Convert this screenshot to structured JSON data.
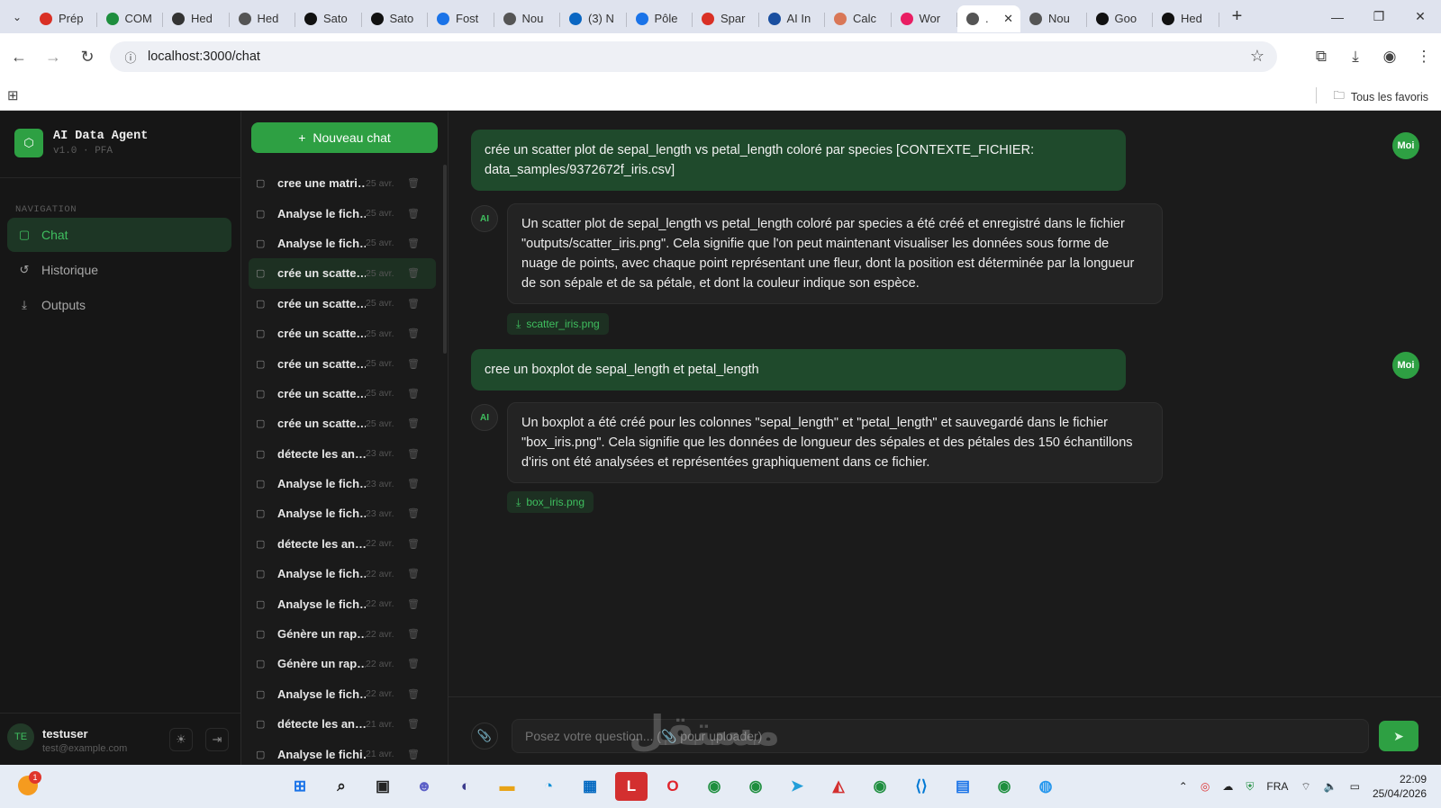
{
  "browser": {
    "tabs": [
      {
        "label": "Prép",
        "icon": "gmail-icon",
        "color": "#d93025"
      },
      {
        "label": "COM",
        "icon": "drive-icon",
        "color": "#1e8e3e"
      },
      {
        "label": "Hed",
        "icon": "hed-icon",
        "color": "#333333"
      },
      {
        "label": "Hed",
        "icon": "globe-icon",
        "color": "#555555"
      },
      {
        "label": "Sato",
        "icon": "sato-icon",
        "color": "#111111"
      },
      {
        "label": "Sato",
        "icon": "sato-icon",
        "color": "#111111"
      },
      {
        "label": "Fost",
        "icon": "fost-icon",
        "color": "#1a73e8"
      },
      {
        "label": "Nou",
        "icon": "globe-icon",
        "color": "#555555"
      },
      {
        "label": "(3) N",
        "icon": "linkedin-icon",
        "color": "#0a66c2"
      },
      {
        "label": "Pôle",
        "icon": "search-icon",
        "color": "#1a73e8"
      },
      {
        "label": "Spar",
        "icon": "gmail-icon",
        "color": "#d93025"
      },
      {
        "label": "AI In",
        "icon": "doc-icon",
        "color": "#1a4fa0"
      },
      {
        "label": "Calc",
        "icon": "claude-icon",
        "color": "#d97757"
      },
      {
        "label": "Wor",
        "icon": "wor-icon",
        "color": "#e91e63"
      },
      {
        "label": ".",
        "icon": "globe-icon",
        "color": "#555555",
        "active": true
      },
      {
        "label": "Nou",
        "icon": "globe-icon",
        "color": "#555555"
      },
      {
        "label": "Goo",
        "icon": "openai-icon",
        "color": "#111111"
      },
      {
        "label": "Hed",
        "icon": "openai-icon",
        "color": "#111111"
      }
    ],
    "url": "localhost:3000/chat",
    "favorites_label": "Tous les favoris"
  },
  "app": {
    "brand_title": "AI Data Agent",
    "brand_sub": "v1.0 · PFA",
    "nav_title": "NAVIGATION",
    "nav": [
      {
        "label": "Chat",
        "icon": "chat-icon",
        "active": true
      },
      {
        "label": "Historique",
        "icon": "history-icon",
        "active": false
      },
      {
        "label": "Outputs",
        "icon": "download-icon",
        "active": false
      }
    ],
    "user": {
      "initials": "TE",
      "name": "testuser",
      "email": "test@example.com"
    },
    "new_chat_label": "Nouveau chat",
    "history": [
      {
        "title": "cree une matri…",
        "date": "25 avr."
      },
      {
        "title": "Analyse le fich…",
        "date": "25 avr."
      },
      {
        "title": "Analyse le fich…",
        "date": "25 avr."
      },
      {
        "title": "crée un scatte…",
        "date": "25 avr.",
        "active": true
      },
      {
        "title": "crée un scatte…",
        "date": "25 avr."
      },
      {
        "title": "crée un scatte…",
        "date": "25 avr."
      },
      {
        "title": "crée un scatte…",
        "date": "25 avr."
      },
      {
        "title": "crée un scatte…",
        "date": "25 avr."
      },
      {
        "title": "crée un scatte…",
        "date": "25 avr."
      },
      {
        "title": "détecte les an…",
        "date": "23 avr."
      },
      {
        "title": "Analyse le fich…",
        "date": "23 avr."
      },
      {
        "title": "Analyse le fich…",
        "date": "23 avr."
      },
      {
        "title": "détecte les an…",
        "date": "22 avr."
      },
      {
        "title": "Analyse le fich…",
        "date": "22 avr."
      },
      {
        "title": "Analyse le fich…",
        "date": "22 avr."
      },
      {
        "title": "Génère un rap…",
        "date": "22 avr."
      },
      {
        "title": "Génère un rap…",
        "date": "22 avr."
      },
      {
        "title": "Analyse le fich…",
        "date": "22 avr."
      },
      {
        "title": "détecte les an…",
        "date": "21 avr."
      },
      {
        "title": "Analyse le fichi…",
        "date": "21 avr."
      }
    ]
  },
  "chat": {
    "user_avatar": "Moi",
    "ai_avatar": "AI",
    "messages": [
      {
        "role": "user",
        "text": "crée un scatter plot de sepal_length vs petal_length coloré par species [CONTEXTE_FICHIER: data_samples/9372672f_iris.csv]"
      },
      {
        "role": "ai",
        "text": "Un scatter plot de sepal_length vs petal_length coloré par species a été créé et enregistré dans le fichier \"outputs/scatter_iris.png\". Cela signifie que l'on peut maintenant visualiser les données sous forme de nuage de points, avec chaque point représentant une fleur, dont la position est déterminée par la longueur de son sépale et de sa pétale, et dont la couleur indique son espèce.",
        "file": "scatter_iris.png"
      },
      {
        "role": "user",
        "text": "cree un  boxplot de sepal_length et petal_length"
      },
      {
        "role": "ai",
        "text": "Un boxplot a été créé pour les colonnes \"sepal_length\" et \"petal_length\" et sauvegardé dans le fichier \"box_iris.png\". Cela signifie que les données de longueur des sépales et des pétales des 150 échantillons d'iris ont été analysées et représentées graphiquement dans ce fichier.",
        "file": "box_iris.png"
      }
    ],
    "input_placeholder": "Posez votre question... (📎 pour uploader)",
    "watermark": "مستقل"
  },
  "taskbar": {
    "weather_badge": "1",
    "language": "FRA",
    "time": "22:09",
    "date": "25/04/2026"
  },
  "colors": {
    "accent": "#2ea043",
    "accent_text": "#3fbf5f",
    "user_bubble": "#1f4a2c",
    "ai_bubble": "#232323"
  }
}
